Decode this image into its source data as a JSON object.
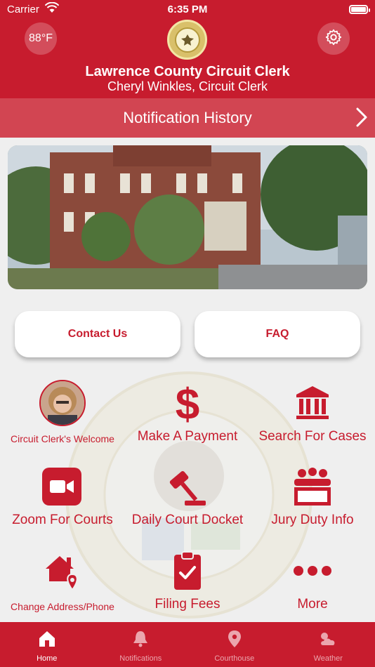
{
  "status_bar": {
    "carrier": "Carrier",
    "time": "6:35 PM"
  },
  "header": {
    "temperature": "88°F",
    "title": "Lawrence County Circuit Clerk",
    "subtitle": "Cheryl Winkles, Circuit Clerk",
    "seal_icon": "county-seal",
    "settings_icon": "gear-icon"
  },
  "notification_bar": {
    "label": "Notification History"
  },
  "buttons": {
    "contact": "Contact Us",
    "faq": "FAQ"
  },
  "tiles": [
    {
      "label": "Circuit Clerk's Welcome",
      "icon": "avatar"
    },
    {
      "label": "Make A Payment",
      "icon": "dollar-icon"
    },
    {
      "label": "Search For Cases",
      "icon": "courthouse-icon"
    },
    {
      "label": "Zoom For Courts",
      "icon": "video-camera-icon"
    },
    {
      "label": "Daily Court Docket",
      "icon": "gavel-icon"
    },
    {
      "label": "Jury Duty Info",
      "icon": "jury-icon"
    },
    {
      "label": "Change Address/Phone",
      "icon": "home-location-icon"
    },
    {
      "label": "Filing Fees",
      "icon": "clipboard-check-icon"
    },
    {
      "label": "More",
      "icon": "more-icon"
    }
  ],
  "tabs": [
    {
      "label": "Home",
      "icon": "home-icon",
      "active": true
    },
    {
      "label": "Notifications",
      "icon": "bell-icon",
      "active": false
    },
    {
      "label": "Courthouse",
      "icon": "map-pin-icon",
      "active": false
    },
    {
      "label": "Weather",
      "icon": "weather-icon",
      "active": false
    }
  ],
  "colors": {
    "brand_red": "#c71c2e",
    "bar_red": "#d24552",
    "background": "#efefef"
  }
}
